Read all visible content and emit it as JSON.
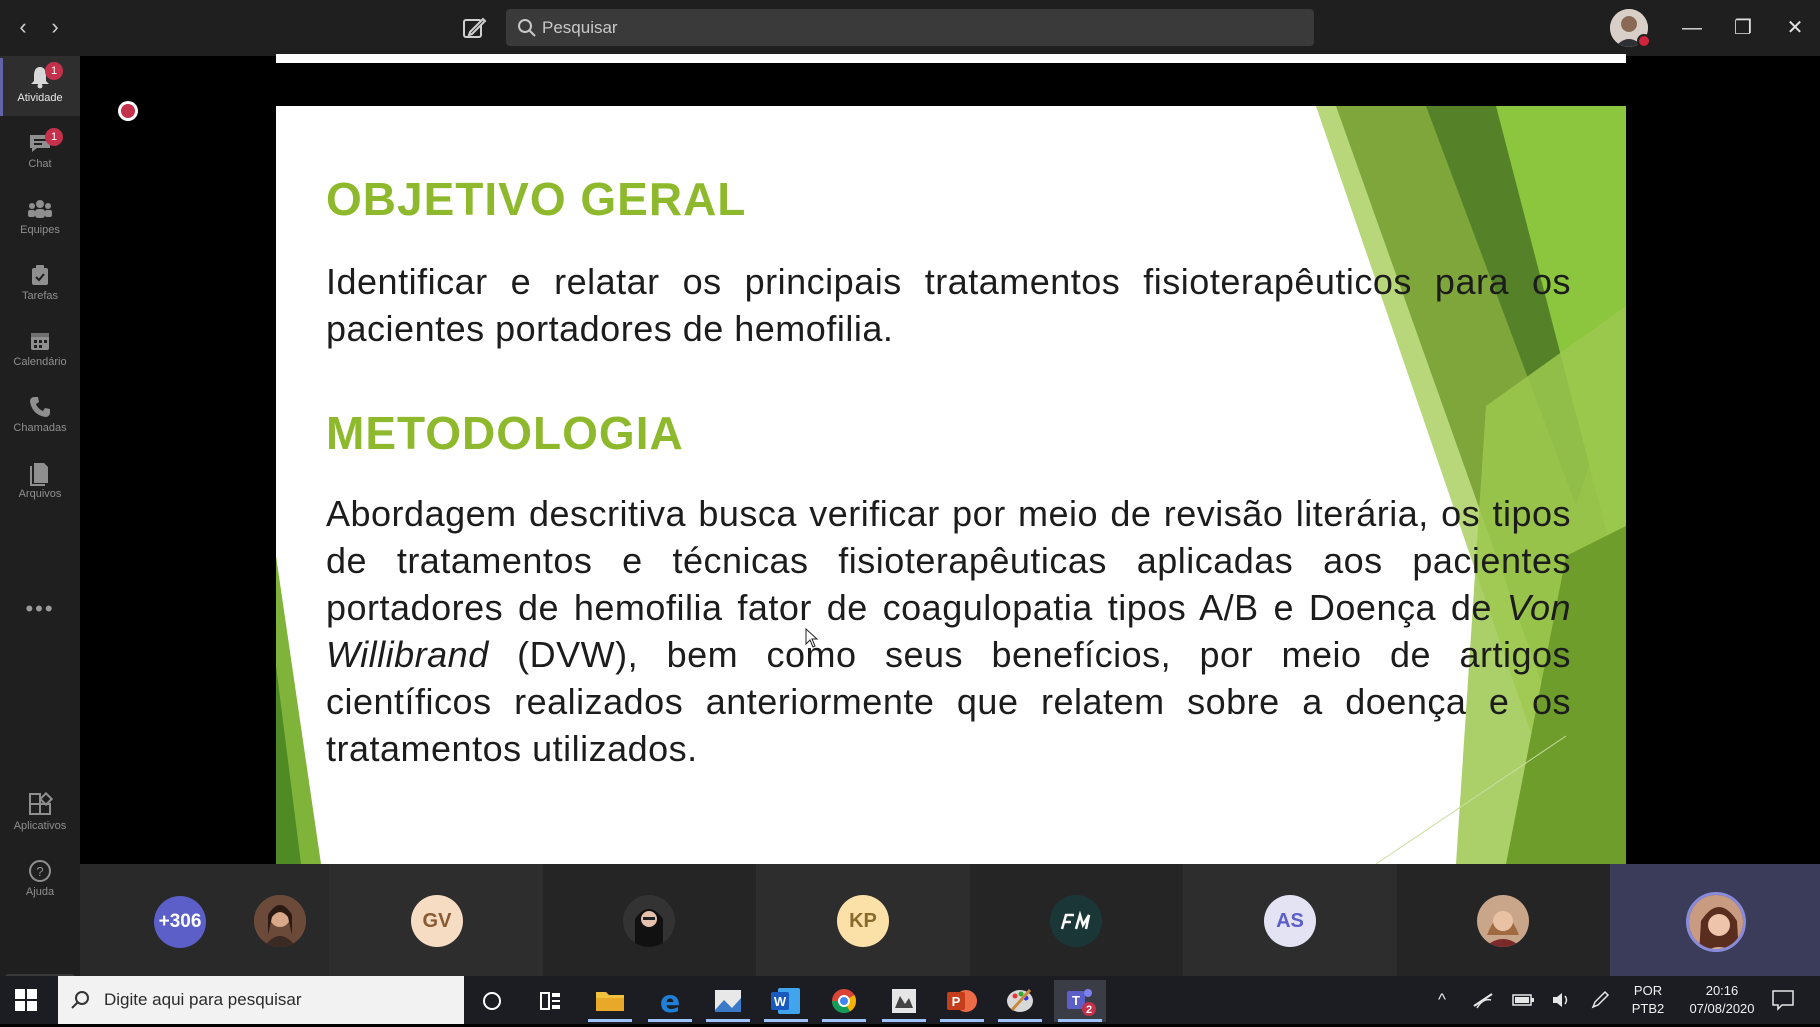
{
  "titlebar": {
    "search_placeholder": "Pesquisar",
    "back_icon": "chevron-left-icon",
    "forward_icon": "chevron-right-icon",
    "compose_icon": "compose-icon",
    "minimize": "—",
    "maximize": "❐",
    "close": "✕"
  },
  "rail": {
    "items": [
      {
        "label": "Atividade",
        "icon": "bell-icon",
        "badge": "1"
      },
      {
        "label": "Chat",
        "icon": "chat-icon",
        "badge": "1"
      },
      {
        "label": "Equipes",
        "icon": "teams-icon"
      },
      {
        "label": "Tarefas",
        "icon": "tasks-icon"
      },
      {
        "label": "Calendário",
        "icon": "calendar-icon"
      },
      {
        "label": "Chamadas",
        "icon": "phone-icon"
      },
      {
        "label": "Arquivos",
        "icon": "files-icon"
      },
      {
        "label": "Aplicativos",
        "icon": "apps-icon"
      },
      {
        "label": "Ajuda",
        "icon": "help-icon"
      }
    ],
    "more": "•••"
  },
  "slide": {
    "heading1": "OBJETIVO GERAL",
    "para1": "Identificar e relatar os principais tratamentos fisioterapêuticos para os pacientes portadores de hemofilia.",
    "heading2": "METODOLOGIA",
    "para2_before": "Abordagem descritiva busca verificar por meio de revisão literária, os tipos de tratamentos e técnicas fisioterapêuticas aplicadas aos pacientes portadores de hemofilia fator de coagulopatia tipos A/B e Doença de ",
    "para2_italic": "Von Willibrand",
    "para2_after": " (DVW), bem como seus benefícios, por meio de artigos científicos realizados anteriormente que relatem sobre a doença e os tratamentos utilizados.",
    "accent_color": "#8fb92d"
  },
  "participants": {
    "more_count": "+306",
    "initials": [
      "GV",
      "KP",
      "AS"
    ]
  },
  "taskbar": {
    "search_placeholder": "Digite aqui para pesquisar",
    "lang_top": "POR",
    "lang_bottom": "PTB2",
    "time": "20:16",
    "date": "07/08/2020",
    "teams_badge": "2"
  }
}
